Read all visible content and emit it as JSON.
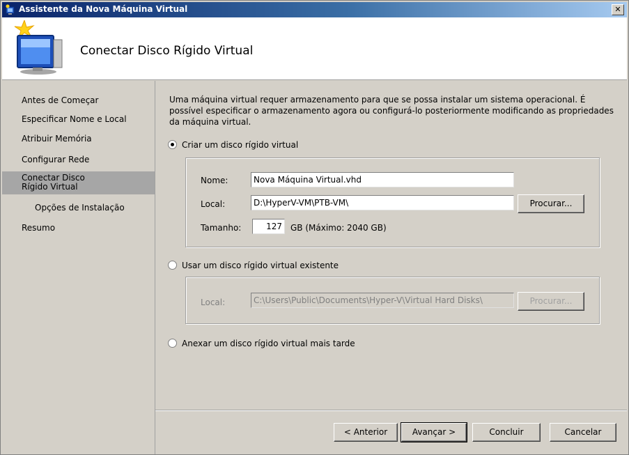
{
  "window": {
    "title": "Assistente da Nova Máquina Virtual",
    "close_label": "✕"
  },
  "header": {
    "page_title": "Conectar Disco Rígido Virtual"
  },
  "sidebar": {
    "items": [
      {
        "label": "Antes de Começar"
      },
      {
        "label": "Especificar Nome e Local"
      },
      {
        "label": "Atribuir Memória"
      },
      {
        "label": "Configurar Rede"
      },
      {
        "label": "Conectar Disco Rígido Virtual",
        "active": true
      },
      {
        "label": "Opções de Instalação",
        "sub": true
      },
      {
        "label": "Resumo"
      }
    ]
  },
  "main": {
    "description": "Uma máquina virtual requer armazenamento para que se possa instalar um sistema operacional. É possível especificar o armazenamento agora ou configurá-lo posteriormente modificando as propriedades da máquina virtual.",
    "create_option": {
      "label": "Criar um disco rígido virtual",
      "selected": true,
      "name_label": "Nome:",
      "name_value": "Nova Máquina Virtual.vhd",
      "location_label": "Local:",
      "location_value": "D:\\HyperV-VM\\PTB-VM\\",
      "browse_label": "Procurar...",
      "size_label": "Tamanho:",
      "size_value": "127",
      "size_suffix": "GB (Máximo: 2040 GB)"
    },
    "existing_option": {
      "label": "Usar um disco rígido virtual existente",
      "selected": false,
      "location_label": "Local:",
      "location_value": "C:\\Users\\Public\\Documents\\Hyper-V\\Virtual Hard Disks\\",
      "browse_label": "Procurar..."
    },
    "later_option": {
      "label": "Anexar um disco rígido virtual mais tarde",
      "selected": false
    }
  },
  "footer": {
    "previous": "< Anterior",
    "next": "Avançar >",
    "finish": "Concluir",
    "cancel": "Cancelar"
  }
}
